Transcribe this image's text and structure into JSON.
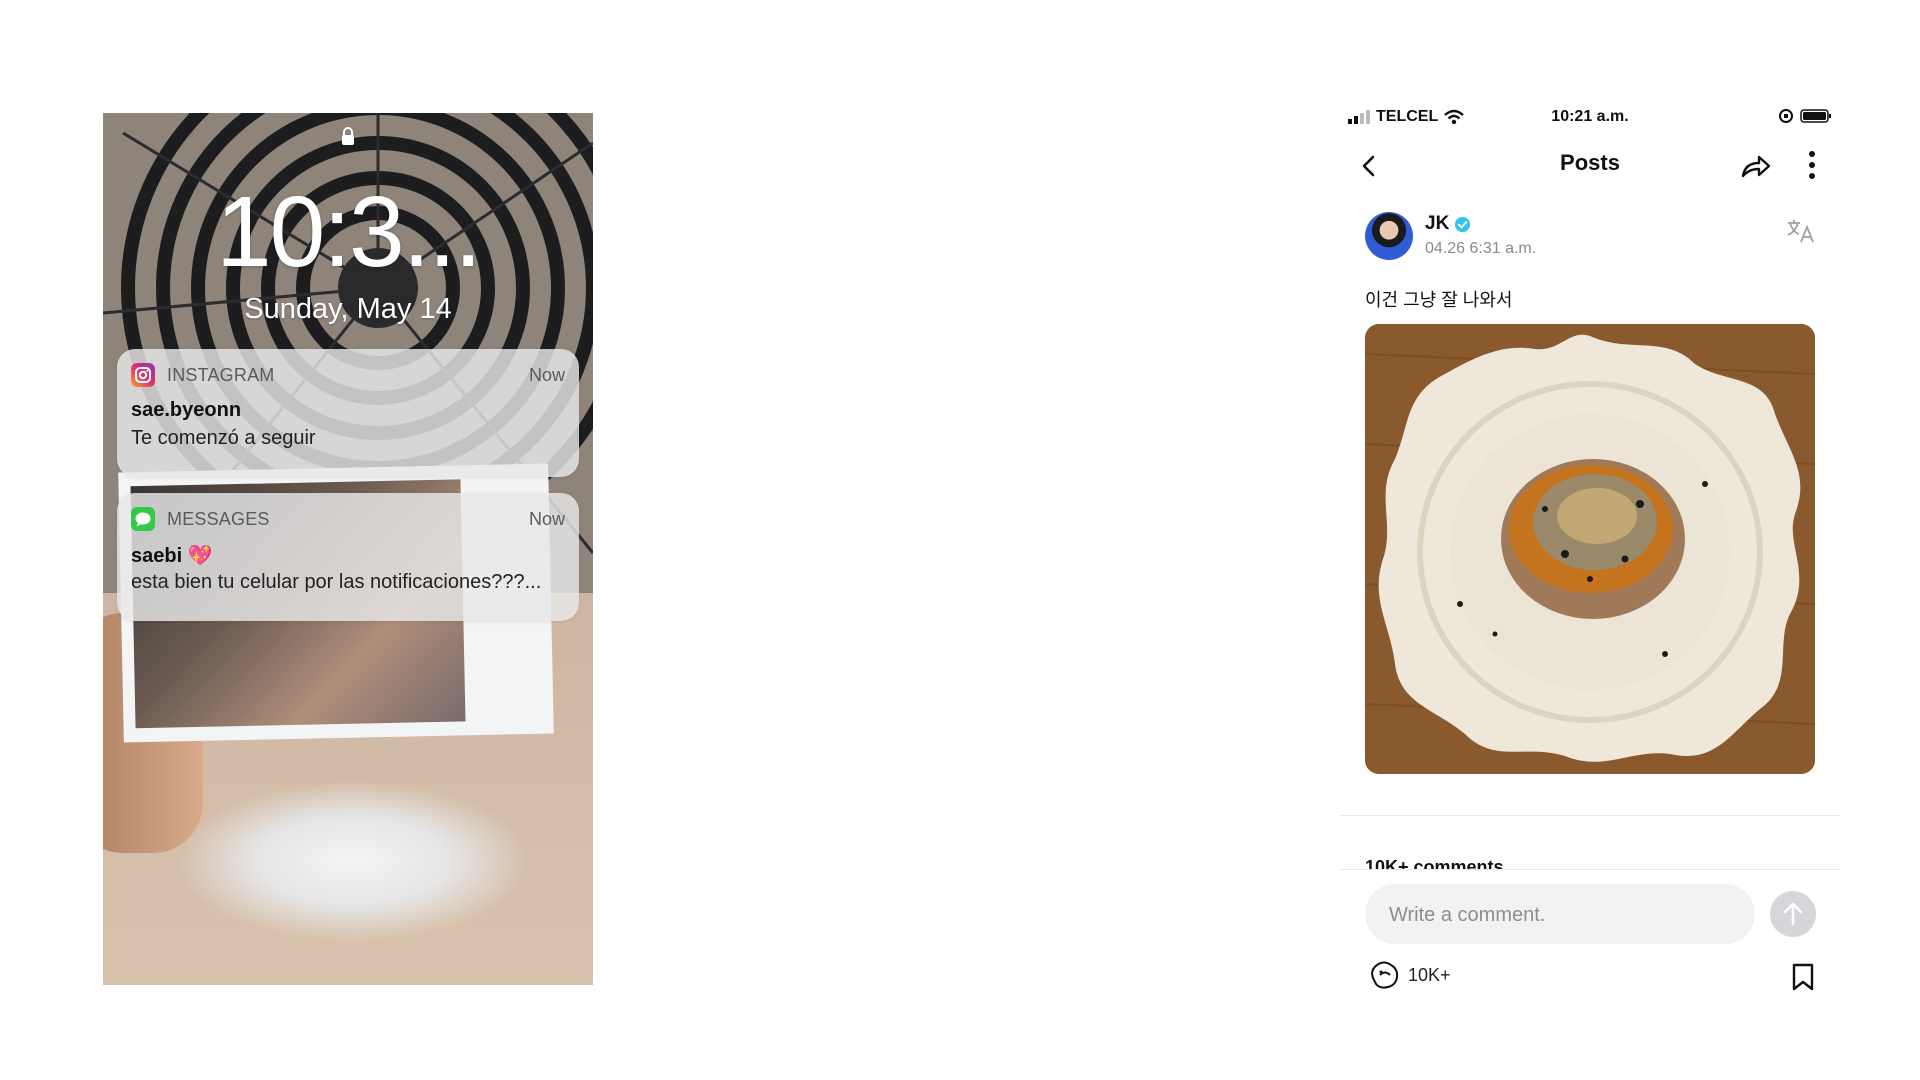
{
  "lock_screen": {
    "time": "10:3...",
    "date": "Sunday, May 14",
    "notifications": [
      {
        "app": "INSTAGRAM",
        "icon": "instagram-icon",
        "when": "Now",
        "title": "sae.byeonn",
        "body": "Te comenzó a seguir"
      },
      {
        "app": "MESSAGES",
        "icon": "messages-icon",
        "when": "Now",
        "title": "saebi 💖",
        "body": "esta bien tu celular por las notificaciones???..."
      }
    ]
  },
  "status_bar": {
    "carrier": "TELCEL",
    "time": "10:21 a.m."
  },
  "nav": {
    "title": "Posts"
  },
  "post": {
    "author": "JK",
    "time": "04.26 6:31 a.m.",
    "caption": "이건 그냥 잘 나와서",
    "comments_label": "10K+ comments",
    "reaction_count": "10K+"
  },
  "comment_input": {
    "placeholder": "Write a comment."
  },
  "colors": {
    "verified": "#35c3ef",
    "instagram_gradient": [
      "#f9a03f",
      "#e1306c",
      "#833ab4"
    ],
    "messages_green": "#33c94b",
    "send_button": "#d4d6da"
  }
}
